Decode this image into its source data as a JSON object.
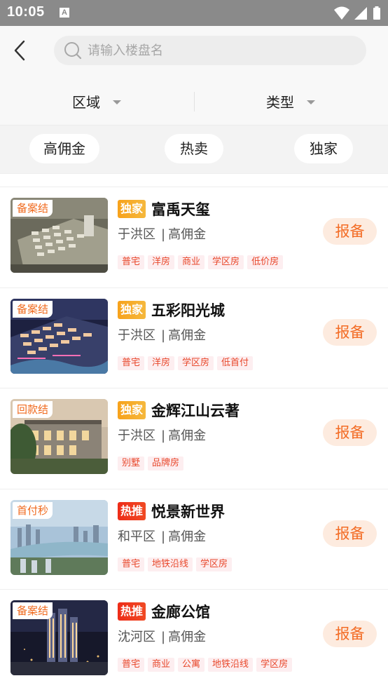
{
  "status_bar": {
    "time": "10:05",
    "notification_icon": "A"
  },
  "search": {
    "placeholder": "请输入楼盘名",
    "value": ""
  },
  "filters": [
    {
      "label": "区域"
    },
    {
      "label": "类型"
    }
  ],
  "quick_tags": [
    {
      "label": "高佣金"
    },
    {
      "label": "热卖"
    },
    {
      "label": "独家"
    }
  ],
  "listings": [
    {
      "thumb_badge": "备案结",
      "hot_badge": "独家",
      "hot_type": "excl",
      "title": "富禹天玺",
      "district": "于洪区",
      "commission": "高佣金",
      "tags": [
        "普宅",
        "洋房",
        "商业",
        "学区房",
        "低价房"
      ],
      "action": "报备"
    },
    {
      "thumb_badge": "备案结",
      "hot_badge": "独家",
      "hot_type": "excl",
      "title": "五彩阳光城",
      "district": "于洪区",
      "commission": "高佣金",
      "tags": [
        "普宅",
        "洋房",
        "学区房",
        "低首付"
      ],
      "action": "报备"
    },
    {
      "thumb_badge": "回款结",
      "hot_badge": "独家",
      "hot_type": "excl",
      "title": "金辉江山云著",
      "district": "于洪区",
      "commission": "高佣金",
      "tags": [
        "别墅",
        "品牌房"
      ],
      "action": "报备"
    },
    {
      "thumb_badge": "首付秒",
      "hot_badge": "热推",
      "hot_type": "hot",
      "title": "悦景新世界",
      "district": "和平区",
      "commission": "高佣金",
      "tags": [
        "普宅",
        "地铁沿线",
        "学区房"
      ],
      "action": "报备"
    },
    {
      "thumb_badge": "备案结",
      "hot_badge": "热推",
      "hot_type": "hot",
      "title": "金廊公馆",
      "district": "沈河区",
      "commission": "高佣金",
      "tags": [
        "普宅",
        "商业",
        "公寓",
        "地铁沿线",
        "学区房"
      ],
      "action": "报备"
    }
  ],
  "colors": {
    "accent": "#f36c25",
    "exclusive": "#f7a21b",
    "hot": "#ee2c18",
    "tag_text": "#e8482c",
    "tag_bg": "#fdeef0"
  }
}
